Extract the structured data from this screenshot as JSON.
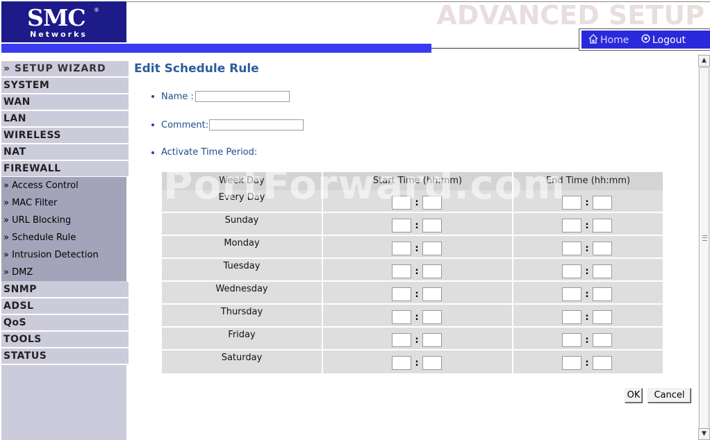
{
  "header": {
    "logo_text": "SMC",
    "logo_reg": "®",
    "logo_sub": "Networks",
    "section_title": "ADVANCED SETUP",
    "home_label": "Home",
    "logout_label": "Logout"
  },
  "sidebar": {
    "wizard": "» SETUP WIZARD",
    "items": [
      "SYSTEM",
      "WAN",
      "LAN",
      "WIRELESS",
      "NAT",
      "FIREWALL"
    ],
    "firewall_sub": [
      "» Access Control",
      "» MAC Filter",
      "» URL Blocking",
      "» Schedule Rule",
      "» Intrusion Detection",
      "» DMZ"
    ],
    "items_after": [
      "SNMP",
      "ADSL",
      "QoS",
      "TOOLS",
      "STATUS"
    ]
  },
  "main": {
    "title": "Edit Schedule Rule",
    "name_label": "Name :",
    "name_value": "",
    "comment_label": "Comment:",
    "comment_value": "",
    "period_label": "Activate Time Period:",
    "table": {
      "headers": [
        "Week Day",
        "Start Time (hh:mm)",
        "End Time (hh:mm)"
      ],
      "days": [
        "Every Day",
        "Sunday",
        "Monday",
        "Tuesday",
        "Wednesday",
        "Thursday",
        "Friday",
        "Saturday"
      ],
      "separator": ":"
    },
    "ok_label": "OK",
    "cancel_label": "Cancel"
  },
  "watermark": "PortForward.com",
  "colors": {
    "header_blue": "#1d1a8a",
    "bar_blue": "#3a3af0",
    "title_blue": "#2b5d9c",
    "sidebar_bg": "#cbcbdb",
    "submenu_bg": "#a3a3b9"
  }
}
